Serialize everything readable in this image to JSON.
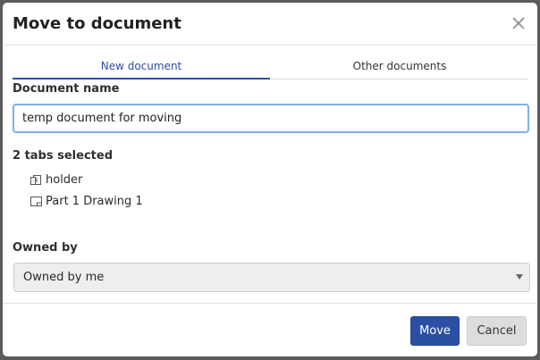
{
  "dialog": {
    "title": "Move to document",
    "close_label": "×"
  },
  "tabs": [
    {
      "label": "New document",
      "active": true
    },
    {
      "label": "Other documents",
      "active": false
    }
  ],
  "document_name": {
    "label": "Document name",
    "value": "temp document for moving"
  },
  "selection": {
    "summary": "2 tabs selected",
    "items": [
      {
        "label": "holder",
        "icon": "assembly-icon"
      },
      {
        "label": "Part 1 Drawing 1",
        "icon": "drawing-icon"
      }
    ]
  },
  "owner": {
    "label": "Owned by",
    "selected": "Owned by me"
  },
  "footer": {
    "move_label": "Move",
    "cancel_label": "Cancel"
  },
  "colors": {
    "accent": "#2c4fa3",
    "input_focus_border": "#7fb0e2"
  }
}
